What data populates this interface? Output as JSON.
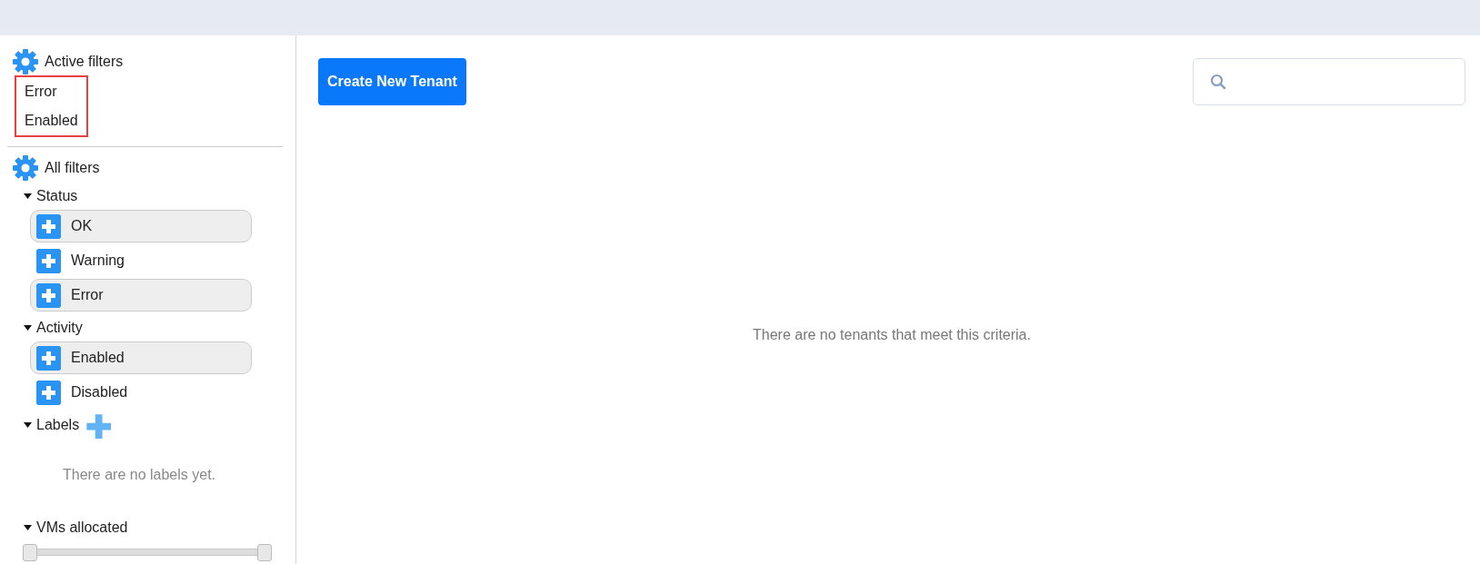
{
  "active_filters": {
    "title": "Active filters",
    "highlighted": true,
    "items": [
      "Error",
      "Enabled"
    ]
  },
  "all_filters": {
    "title": "All filters",
    "sections": [
      {
        "kind": "options",
        "label": "Status",
        "expanded": true,
        "options": [
          {
            "label": "OK",
            "selected": true
          },
          {
            "label": "Warning",
            "selected": false
          },
          {
            "label": "Error",
            "selected": true
          }
        ]
      },
      {
        "kind": "options",
        "label": "Activity",
        "expanded": true,
        "options": [
          {
            "label": "Enabled",
            "selected": true
          },
          {
            "label": "Disabled",
            "selected": false
          }
        ]
      },
      {
        "kind": "labels",
        "label": "Labels",
        "expanded": true,
        "empty_text": "There are no labels yet."
      },
      {
        "kind": "range",
        "label": "VMs allocated",
        "expanded": true,
        "thumbs": [
          {
            "level": 0
          },
          {
            "level": 1
          }
        ]
      }
    ]
  },
  "toolbar": {
    "create_button": "Create New Tenant"
  },
  "empty_message": "There are no tenants that meet this criteria."
}
